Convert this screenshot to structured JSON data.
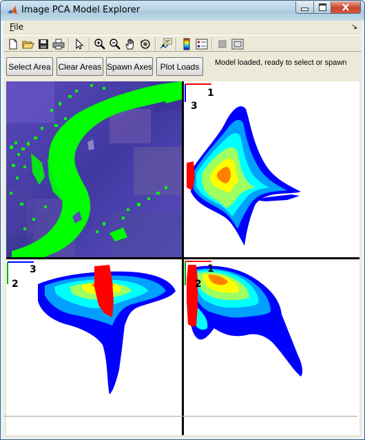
{
  "window": {
    "title": "Image PCA Model Explorer",
    "colors": {
      "titlebar": "#b7d3e6",
      "close": "#c6452c",
      "chrome": "#ece9d8"
    }
  },
  "menu": {
    "file_label": "File",
    "file_mnemonic": "F",
    "file_rest": "ile",
    "dock_glyph": "↘"
  },
  "toolbar": {
    "icons": [
      "new-file-icon",
      "open-folder-icon",
      "save-icon",
      "print-icon",
      "pointer-icon",
      "zoom-in-icon",
      "zoom-out-icon",
      "pan-hand-icon",
      "rotate-3d-icon",
      "data-cursor-icon",
      "colorbar-icon",
      "legend-icon",
      "hide-plot-tools-icon",
      "show-plot-tools-icon"
    ]
  },
  "buttons": {
    "select_area": "Select Area",
    "clear_areas": "Clear Areas",
    "spawn_axes": "Spawn Axes",
    "plot_loads": "Plot Loads"
  },
  "status_text": "Model loaded, ready to select or spawn",
  "plots": {
    "image_panel": {
      "selection_color": "#00ff00"
    },
    "scores_1_3": {
      "x_component": "1",
      "y_component": "3",
      "x_axis_color": "#ff0000",
      "y_axis_color": "#0000ff"
    },
    "scores_3_2": {
      "x_component": "3",
      "y_component": "2",
      "x_axis_color": "#0000ff",
      "y_axis_color": "#00aa00"
    },
    "scores_1_2": {
      "x_component": "1",
      "y_component": "2",
      "x_axis_color": "#ff0000",
      "y_axis_color": "#00aa00"
    },
    "selection_color": "#ff0000",
    "density_colormap": [
      "#0000ff",
      "#00a0ff",
      "#00ffff",
      "#a0ff60",
      "#ffff00",
      "#ff8000"
    ]
  }
}
